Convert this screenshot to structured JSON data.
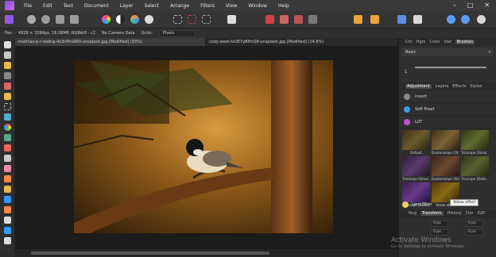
{
  "menubar": {
    "items": [
      "File",
      "Edit",
      "Text",
      "Document",
      "Layer",
      "Select",
      "Arrange",
      "Filters",
      "View",
      "Window",
      "Help"
    ],
    "controls": [
      "–",
      "□",
      "✕"
    ]
  },
  "context": {
    "tool": "Pan",
    "info": "4928 × 3264px, 16.08MP, RGBA/8 - c2",
    "camera": "No Camera Data",
    "units_label": "Units:",
    "units_value": "Pixels"
  },
  "doc_tabs": [
    {
      "title": "mathias-p-r-reding-4s3nPnsWtII-unsplash.jpg [Modified] (93%)",
      "active": true
    },
    {
      "title": "cody-west-fxOE7yBHnQ8-unsplash.jpg [Modified] (14.6%)",
      "active": false
    }
  ],
  "panel_tabs": {
    "items": [
      "Chr",
      "Hgm",
      "Color",
      "Swt",
      "Brushes"
    ],
    "active": "Brushes"
  },
  "brushes": {
    "category": "Basic",
    "preview_size": "1"
  },
  "adj_tabs": {
    "items": [
      "Adjustment",
      "Layers",
      "Effects",
      "Styles"
    ],
    "active": "Adjustment"
  },
  "adjustments": [
    {
      "label": "Invert",
      "icon": "invert-icon",
      "color": "#888888"
    },
    {
      "label": "Soft Proof",
      "icon": "soft-proof-icon",
      "color": "#3aa0e8"
    },
    {
      "label": "LUT",
      "icon": "lut-icon",
      "color": "#c84fd8"
    }
  ],
  "presets": [
    {
      "label": "Default",
      "tint": "#6a5a2c"
    },
    {
      "label": "Duotone/ope (Ot...",
      "tint": "#7a6235"
    },
    {
      "label": "Tricorope (Simul...",
      "tint": "#5e6a2e"
    },
    {
      "label": "Tritanope (Simul...",
      "tint": "#5a3a6a"
    },
    {
      "label": "Duotone/ope (Sim...",
      "tint": "#6a4a30"
    },
    {
      "label": "Tricorope (Dalto...",
      "tint": "#5a6230"
    },
    {
      "label": "Tritanope (Dalton...",
      "tint": "#6a3a8a"
    },
    {
      "label": "Yellow effect",
      "tint": "#8a6a14"
    }
  ],
  "tooltip": "Yellow effect",
  "lens_filter": "Lens Filter",
  "nav_tabs": {
    "items": [
      "Nvg",
      "Transform",
      "History",
      "Chn",
      "32P"
    ],
    "active": "Transform"
  },
  "transform_fields": [
    "0 px",
    "0 px",
    "0 px",
    "0 px"
  ],
  "watermark": {
    "title": "Activate Windows",
    "subtitle": "Go to Settings to activate Windows."
  }
}
